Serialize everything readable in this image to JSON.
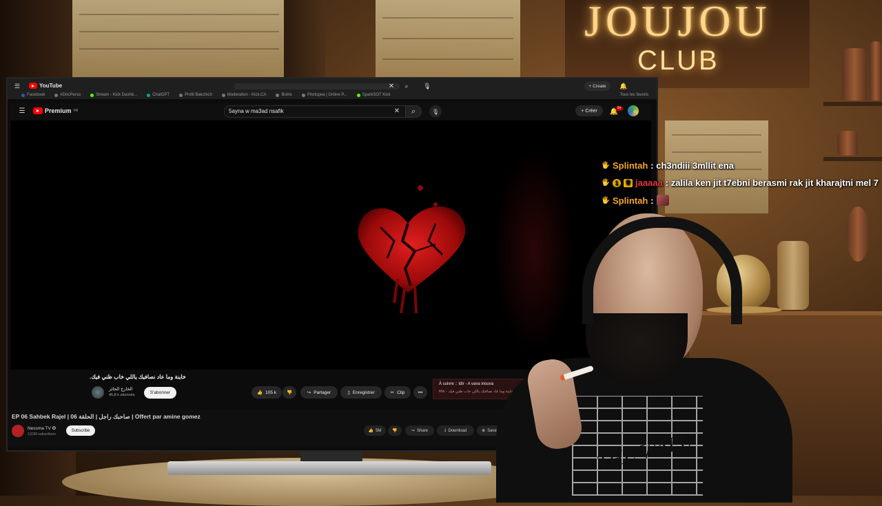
{
  "stream_overlay": {
    "sign_title": "JOUJOU",
    "sign_subtitle": "CLUB",
    "shirt_text": "THE WALL"
  },
  "browser": {
    "top_logo": "YouTube",
    "top_create": "Create",
    "bookmarks": [
      "Facebook",
      "#DocPerso",
      "Stream - Kick Dashb...",
      "ChatGPT",
      "Profil Bakchich",
      "Moderation - Kick.CA",
      "Botrix",
      "Photopea | Online P...",
      "SparkSOT Kick"
    ],
    "bookmarks_right": "Tous les favoris"
  },
  "youtube": {
    "logo": "Premium",
    "logo_region": "FR",
    "search_value": "5ayna w ma3ad nsafik",
    "create_label": "Créer",
    "notif_count": "9+",
    "video_title": ".خاينة وما عاد نصافيك ياللي خاب ظني فيك",
    "channel_name": "الخارج الحائر",
    "channel_subs": "45,8 k abonnés",
    "subscribe_label": "S'abonner",
    "like_count": "105 k",
    "share_label": "Partager",
    "save_label": "Enregistrer",
    "clip_label": "Clip",
    "more_label": "•••",
    "up_next_title": "À suivre :: Idir - A vava inouva",
    "up_next_sub": "Mix - خاينة وما عاد نصافيك ياللي خاب ظني فيك."
  },
  "second_video": {
    "title": "EP 06 Sahbek Rajel | صاحبك راجل | الحلقة 06 | Offert par amine gomez",
    "channel_name": "Nessma TV ✪",
    "channel_subs": "2,83M subscribers",
    "subscribe_label": "Subscribe",
    "like_count": "5M",
    "share_label": "Share",
    "download_label": "Download",
    "save_label": "Save"
  },
  "chat": [
    {
      "user": "Splintah",
      "user_color": "#f7a62a",
      "badges": [],
      "message": ": ch3ndiii 3mllit ena"
    },
    {
      "user": "jaaaaa",
      "user_color": "#e0383e",
      "badges": [
        "1",
        "crown"
      ],
      "message": ": zalila ken jit t7ebni berasmi rak jit kharajtni mel 7"
    },
    {
      "user": "Splintah",
      "user_color": "#f7a62a",
      "badges": [],
      "message": ":",
      "emote": "emote"
    }
  ],
  "colors": {
    "yt_red": "#ff0000",
    "chat_gold": "#f7a62a",
    "chat_red": "#e0383e"
  }
}
